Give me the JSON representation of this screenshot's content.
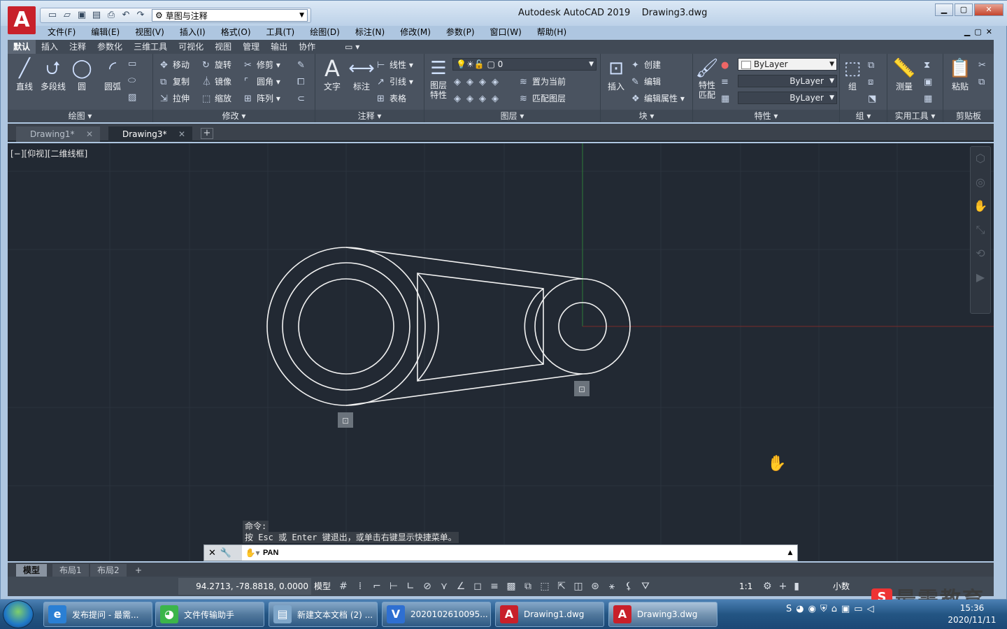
{
  "app": {
    "logo": "A",
    "title": "Autodesk AutoCAD 2019",
    "document": "Drawing3.dwg"
  },
  "qat": {
    "workspace": "草图与注释",
    "icons": [
      "new-icon",
      "open-icon",
      "save-icon",
      "saveas-icon",
      "print-icon",
      "undo-icon",
      "redo-icon",
      "gear-icon"
    ]
  },
  "menubar": [
    "文件(F)",
    "编辑(E)",
    "视图(V)",
    "插入(I)",
    "格式(O)",
    "工具(T)",
    "绘图(D)",
    "标注(N)",
    "修改(M)",
    "参数(P)",
    "窗口(W)",
    "帮助(H)"
  ],
  "ribbon_tabs": [
    "默认",
    "插入",
    "注释",
    "参数化",
    "三维工具",
    "可视化",
    "视图",
    "管理",
    "输出",
    "协作"
  ],
  "ribbon_tab_extra": "▭ ▾",
  "panels": {
    "draw": {
      "title": "绘图",
      "line": "直线",
      "polyline": "多段线",
      "circle": "圆",
      "arc": "圆弧"
    },
    "modify": {
      "title": "修改",
      "move": "移动",
      "rotate": "旋转",
      "trim": "修剪",
      "copy": "复制",
      "mirror": "镜像",
      "fillet": "圆角",
      "stretch": "拉伸",
      "scale": "缩放",
      "array": "阵列"
    },
    "annotation": {
      "title": "注释",
      "text": "文字",
      "dimension": "标注",
      "linear": "线性",
      "leader": "引线",
      "table": "表格"
    },
    "layers": {
      "title": "图层",
      "props": "图层\n特性",
      "current_layer": "0",
      "make_current": "置为当前",
      "match_layer": "匹配图层"
    },
    "block": {
      "title": "块",
      "insert": "插入",
      "create": "创建",
      "edit": "编辑",
      "edit_attr": "编辑属性"
    },
    "properties": {
      "title": "特性",
      "match": "特性\n匹配",
      "color": "ByLayer",
      "linetype": "ByLayer",
      "lineweight": "ByLayer"
    },
    "groups": {
      "title": "组",
      "group": "组"
    },
    "utilities": {
      "title": "实用工具",
      "measure": "测量"
    },
    "clipboard": {
      "title": "剪贴板",
      "paste": "粘贴"
    }
  },
  "doc_tabs": [
    {
      "label": "Drawing1*",
      "active": false
    },
    {
      "label": "Drawing3*",
      "active": true
    }
  ],
  "viewport": {
    "label": "[−][仰视][二维线框]"
  },
  "command": {
    "history": [
      "命令:",
      "按 Esc 或 Enter 键退出，或单击右键显示快捷菜单。"
    ],
    "current": "PAN"
  },
  "layout_tabs": [
    {
      "label": "模型",
      "active": true
    },
    {
      "label": "布局1",
      "active": false
    },
    {
      "label": "布局2",
      "active": false
    }
  ],
  "status": {
    "coords": "94.2713, -78.8818, 0.0000",
    "mode": "模型",
    "scale": "1:1",
    "units": "小数"
  },
  "watermark": {
    "logo": "S",
    "text": "最需教育"
  },
  "taskbar": {
    "items": [
      {
        "label": "发布提问 - 最需...",
        "icon": "ie-icon",
        "color": "#2a7fd4"
      },
      {
        "label": "文件传输助手",
        "icon": "wechat-icon",
        "color": "#3bb54a"
      },
      {
        "label": "新建文本文档 (2) ...",
        "icon": "notepad-icon",
        "color": "#7fa6c9"
      },
      {
        "label": "2020102610095...",
        "icon": "video-icon",
        "color": "#2e6fd1"
      },
      {
        "label": "Drawing1.dwg",
        "icon": "autocad-icon",
        "color": "#c8202a"
      },
      {
        "label": "Drawing3.dwg",
        "icon": "autocad-icon",
        "color": "#c8202a"
      }
    ],
    "time": "15:36",
    "date": "2020/11/11"
  }
}
